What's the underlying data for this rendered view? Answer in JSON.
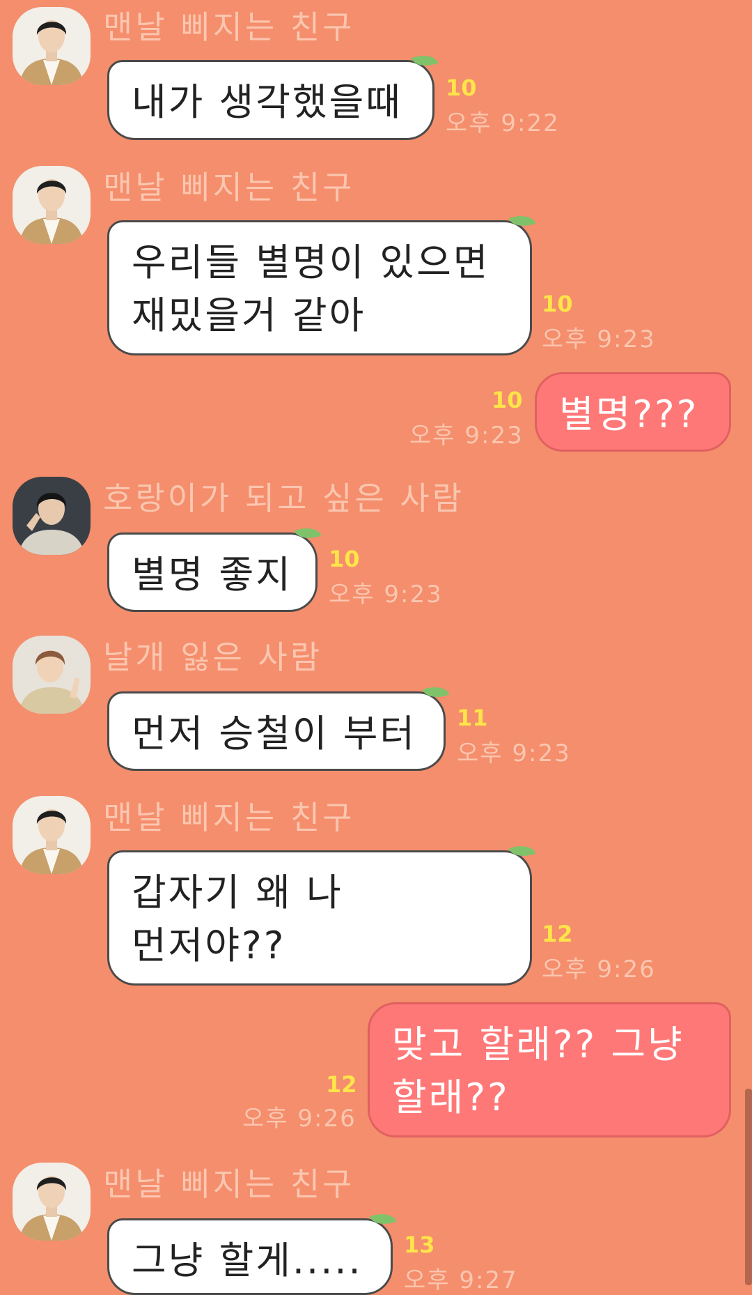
{
  "messages": [
    {
      "sender": "맨날 삐지는 친구",
      "text": "내가 생각했을때",
      "unread": "10",
      "time": "오후 9:22"
    },
    {
      "sender": "맨날 삐지는 친구",
      "text_lines": [
        "우리들 별명이 있으면",
        "재밌을거 같아"
      ],
      "unread": "10",
      "time": "오후 9:23"
    },
    {
      "sender": "",
      "text": "별명???",
      "unread": "10",
      "time": "오후 9:23"
    },
    {
      "sender": "호랑이가 되고 싶은 사람",
      "text": "별명 좋지",
      "unread": "10",
      "time": "오후 9:23"
    },
    {
      "sender": "날개 잃은 사람",
      "text": "먼저 승철이 부터",
      "unread": "11",
      "time": "오후 9:23"
    },
    {
      "sender": "맨날 삐지는 친구",
      "text_lines": [
        "갑자기 왜 나",
        "먼저야??"
      ],
      "unread": "12",
      "time": "오후 9:26"
    },
    {
      "sender": "",
      "text_lines": [
        "맞고 할래?? 그냥",
        "할래??"
      ],
      "unread": "12",
      "time": "오후 9:26"
    },
    {
      "sender": "맨날 삐지는 친구",
      "text": "그냥 할게.....",
      "unread": "13",
      "time": "오후 9:27"
    }
  ],
  "colors": {
    "background": "#F48E6C",
    "incoming_bubble": "#FFFFFF",
    "outgoing_bubble": "#FF7878",
    "unread_count": "#FFE44A",
    "meta_text": "#FBC6B0"
  }
}
